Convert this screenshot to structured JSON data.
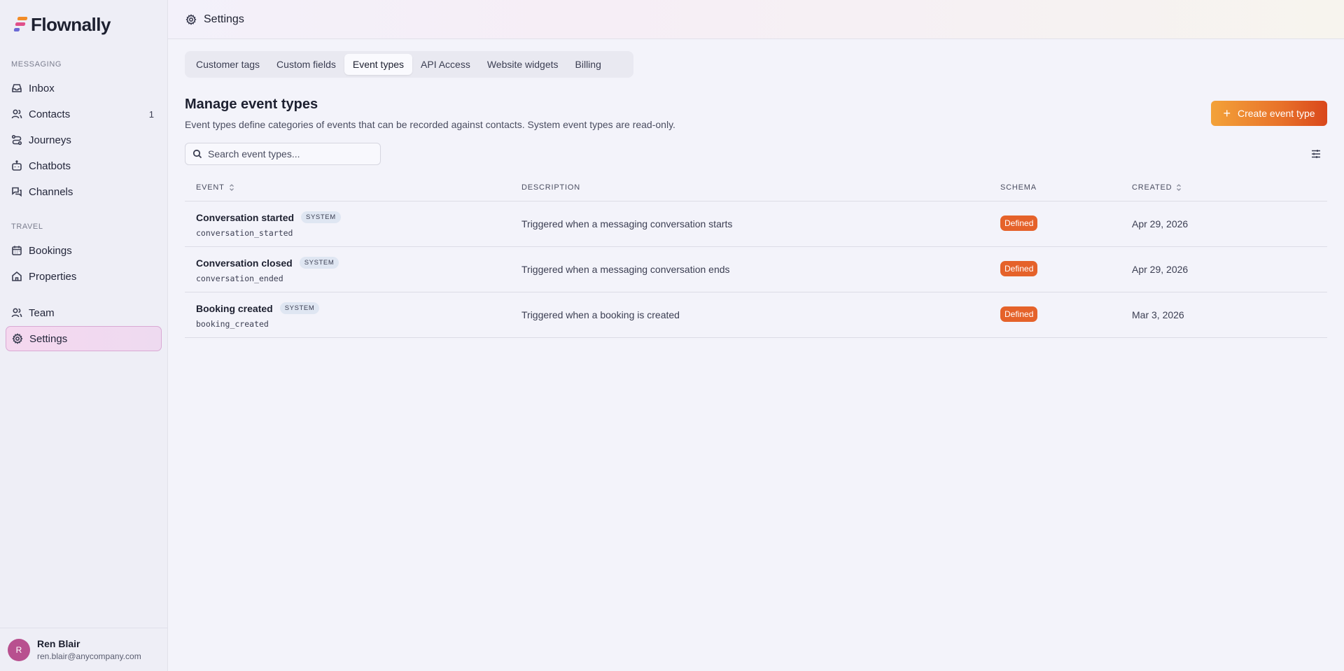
{
  "app": {
    "name": "Flownally"
  },
  "sidebar": {
    "sections": [
      {
        "label": "MESSAGING"
      },
      {
        "label": "TRAVEL"
      }
    ],
    "items": [
      {
        "label": "Inbox",
        "icon": "inbox-icon"
      },
      {
        "label": "Contacts",
        "icon": "users-icon",
        "count": "1"
      },
      {
        "label": "Journeys",
        "icon": "route-icon"
      },
      {
        "label": "Chatbots",
        "icon": "bot-icon"
      },
      {
        "label": "Channels",
        "icon": "chat-icon"
      },
      {
        "label": "Bookings",
        "icon": "calendar-icon"
      },
      {
        "label": "Properties",
        "icon": "home-icon"
      },
      {
        "label": "Team",
        "icon": "team-icon"
      },
      {
        "label": "Settings",
        "icon": "gear-icon",
        "active": true
      }
    ]
  },
  "user": {
    "initial": "R",
    "name": "Ren Blair",
    "email": "ren.blair@anycompany.com"
  },
  "header": {
    "title": "Settings"
  },
  "tabs": [
    {
      "label": "Customer tags"
    },
    {
      "label": "Custom fields"
    },
    {
      "label": "Event types",
      "active": true
    },
    {
      "label": "API Access"
    },
    {
      "label": "Website widgets"
    },
    {
      "label": "Billing"
    }
  ],
  "page": {
    "title": "Manage event types",
    "description": "Event types define categories of events that can be recorded against contacts. System event types are read-only.",
    "create_label": "Create event type",
    "search_placeholder": "Search event types..."
  },
  "table": {
    "columns": {
      "event": "EVENT",
      "description": "DESCRIPTION",
      "schema": "SCHEMA",
      "created": "CREATED"
    },
    "rows": [
      {
        "name": "Conversation started",
        "badge": "SYSTEM",
        "key": "conversation_started",
        "description": "Triggered when a messaging conversation starts",
        "schema": "Defined",
        "created": "Apr 29, 2026"
      },
      {
        "name": "Conversation closed",
        "badge": "SYSTEM",
        "key": "conversation_ended",
        "description": "Triggered when a messaging conversation ends",
        "schema": "Defined",
        "created": "Apr 29, 2026"
      },
      {
        "name": "Booking created",
        "badge": "SYSTEM",
        "key": "booking_created",
        "description": "Triggered when a booking is created",
        "schema": "Defined",
        "created": "Mar 3, 2026"
      }
    ]
  },
  "colors": {
    "accent": "#e5622a",
    "active_nav": "#f5d8ef",
    "avatar": "#b8508f"
  }
}
